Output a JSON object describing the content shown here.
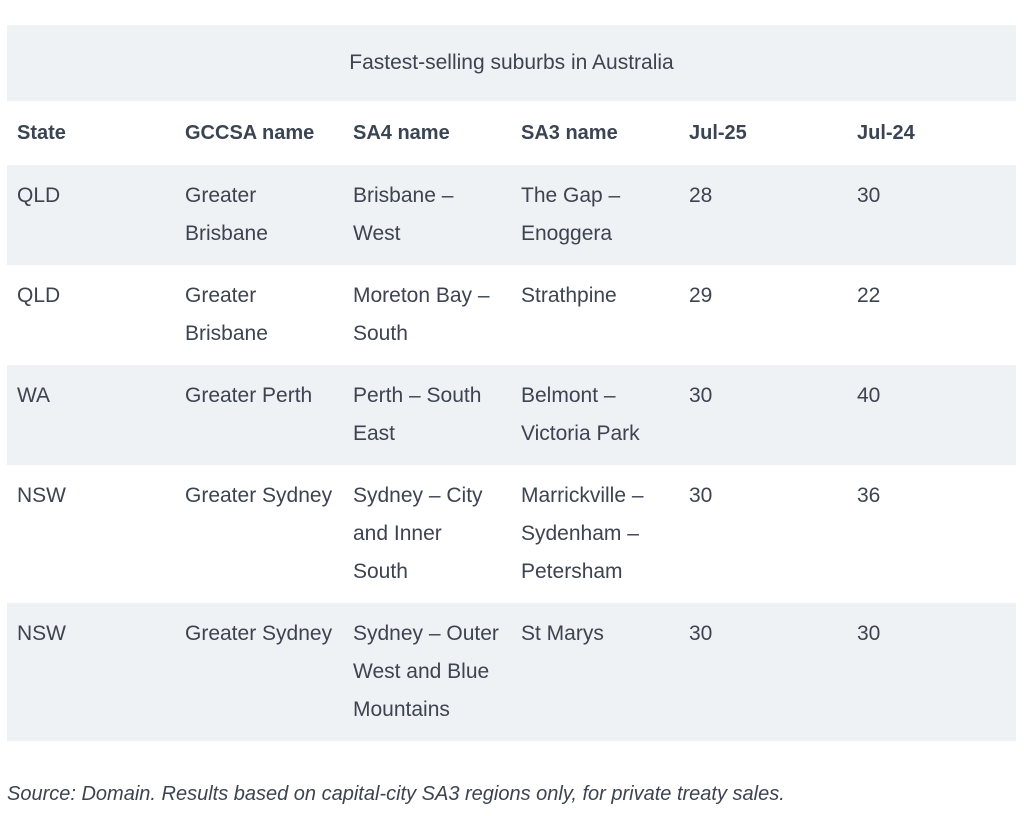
{
  "caption": "Fastest-selling suburbs in Australia",
  "headers": [
    "State",
    "GCCSA name",
    "SA4 name",
    "SA3 name",
    "Jul-25",
    "Jul-24"
  ],
  "rows": [
    [
      "QLD",
      "Greater Brisbane",
      "Brisbane – West",
      "The Gap – Enoggera",
      "28",
      "30"
    ],
    [
      "QLD",
      "Greater Brisbane",
      "Moreton Bay – South",
      "Strathpine",
      "29",
      "22"
    ],
    [
      "WA",
      "Greater Perth",
      "Perth – South East",
      "Belmont – Victoria Park",
      "30",
      "40"
    ],
    [
      "NSW",
      "Greater Sydney",
      "Sydney – City and Inner South",
      "Marrickville – Sydenham – Petersham",
      "30",
      "36"
    ],
    [
      "NSW",
      "Greater Sydney",
      "Sydney – Outer West and Blue Mountains",
      "St Marys",
      "30",
      "30"
    ]
  ],
  "source": "Source: Domain. Results based on capital-city SA3 regions only, for private treaty sales.",
  "colors": {
    "stripe": "#eef2f5",
    "text": "#3d4350"
  }
}
